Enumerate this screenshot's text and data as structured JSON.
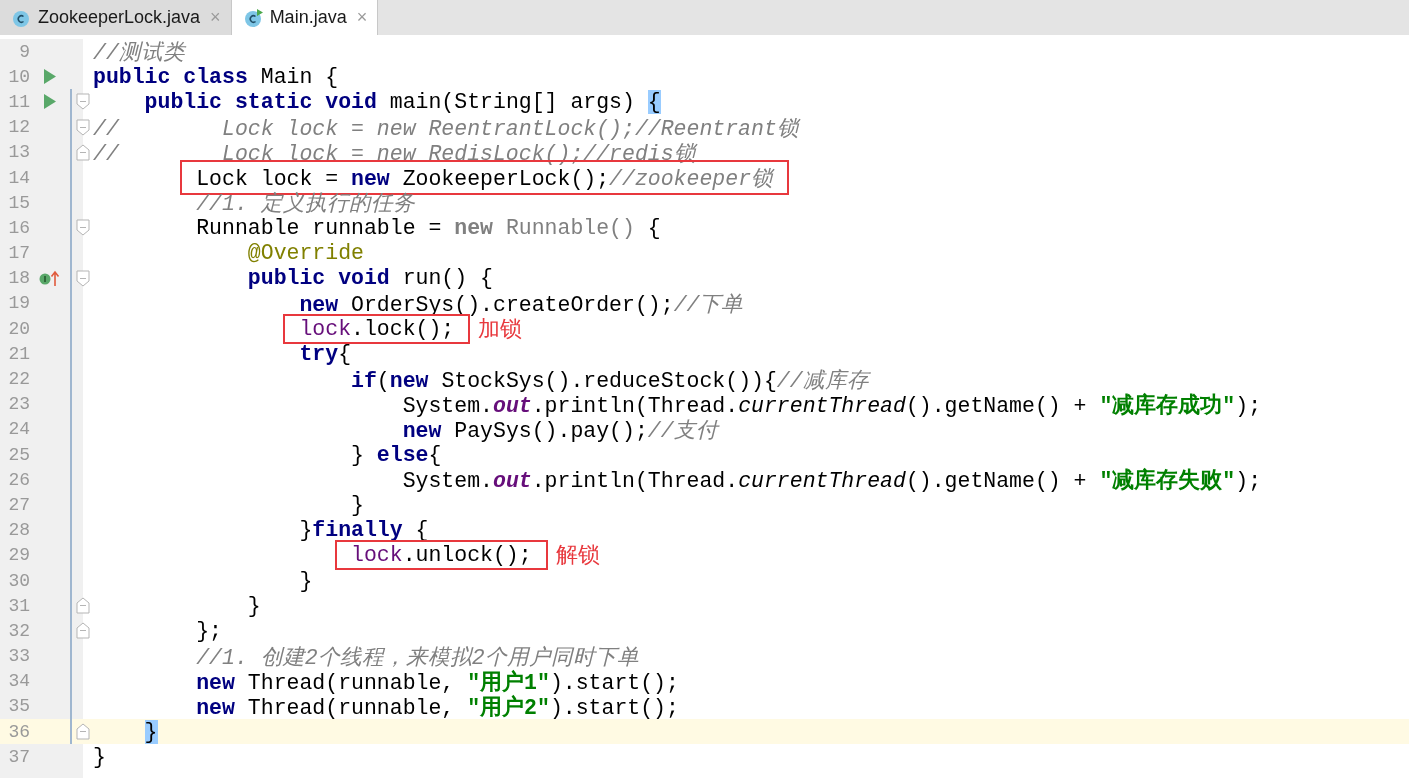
{
  "tabs": [
    {
      "label": "ZookeeperLock.java",
      "selected": false,
      "executable": false,
      "close": "×"
    },
    {
      "label": "Main.java",
      "selected": true,
      "executable": true,
      "close": "×"
    }
  ],
  "lines": [
    {
      "number": "9",
      "current": false,
      "scope": false,
      "tokens": [
        {
          "kind": "comment",
          "text": "//测试类"
        }
      ]
    },
    {
      "number": "10",
      "current": false,
      "scope": false,
      "run_icon": true,
      "tokens": [
        {
          "kind": "keyword",
          "text": "public class"
        },
        {
          "kind": "plain",
          "text": " Main {"
        }
      ]
    },
    {
      "number": "11",
      "current": false,
      "scope": true,
      "run_icon": true,
      "fold_start": true,
      "tokens": [
        {
          "kind": "keyword",
          "text": "    public static void"
        },
        {
          "kind": "plain",
          "text": " main(String[] args) "
        },
        {
          "kind": "brace",
          "text": "{"
        }
      ]
    },
    {
      "number": "12",
      "current": false,
      "scope": true,
      "fold_start": true,
      "tokens": [
        {
          "kind": "comment",
          "text": "//        Lock lock = new ReentrantLock();//Reentrant锁"
        }
      ]
    },
    {
      "number": "13",
      "current": false,
      "scope": true,
      "fold_end": true,
      "tokens": [
        {
          "kind": "comment",
          "text": "//        Lock lock = new RedisLock();//redis锁"
        }
      ]
    },
    {
      "number": "14",
      "current": false,
      "scope": true,
      "tokens": [
        {
          "kind": "box",
          "tokens": [
            {
              "kind": "plain",
              "text": "        Lock lock = "
            },
            {
              "kind": "keyword",
              "text": "new"
            },
            {
              "kind": "plain",
              "text": " ZookeeperLock();"
            },
            {
              "kind": "comment",
              "text": "//zookeeper锁"
            }
          ]
        }
      ]
    },
    {
      "number": "15",
      "current": false,
      "scope": true,
      "tokens": [
        {
          "kind": "comment",
          "text": "        //1. 定义执行的任务"
        }
      ]
    },
    {
      "number": "16",
      "current": false,
      "scope": true,
      "fold_start": true,
      "tokens": [
        {
          "kind": "plain",
          "text": "        Runnable runnable = "
        },
        {
          "kind": "dim_keyword",
          "text": "new"
        },
        {
          "kind": "dim",
          "text": " Runnable()"
        },
        {
          "kind": "plain",
          "text": " {"
        }
      ]
    },
    {
      "number": "17",
      "current": false,
      "scope": true,
      "tokens": [
        {
          "kind": "annotation",
          "text": "            @Override"
        }
      ]
    },
    {
      "number": "18",
      "current": false,
      "scope": true,
      "override_icon": true,
      "fold_start": true,
      "tokens": [
        {
          "kind": "keyword",
          "text": "            public void"
        },
        {
          "kind": "plain",
          "text": " run() {"
        }
      ]
    },
    {
      "number": "19",
      "current": false,
      "scope": true,
      "tokens": [
        {
          "kind": "keyword",
          "text": "                new"
        },
        {
          "kind": "plain",
          "text": " OrderSys().createOrder();"
        },
        {
          "kind": "comment",
          "text": "//下单"
        }
      ]
    },
    {
      "number": "20",
      "current": false,
      "scope": true,
      "tokens": [
        {
          "kind": "box",
          "note": "加锁",
          "tokens": [
            {
              "kind": "local",
              "text": "                lock"
            },
            {
              "kind": "plain",
              "text": ".lock();"
            }
          ]
        }
      ]
    },
    {
      "number": "21",
      "current": false,
      "scope": true,
      "tokens": [
        {
          "kind": "keyword",
          "text": "                try"
        },
        {
          "kind": "plain",
          "text": "{"
        }
      ]
    },
    {
      "number": "22",
      "current": false,
      "scope": true,
      "tokens": [
        {
          "kind": "keyword",
          "text": "                    if"
        },
        {
          "kind": "plain",
          "text": "("
        },
        {
          "kind": "keyword",
          "text": "new"
        },
        {
          "kind": "plain",
          "text": " StockSys().reduceStock()){"
        },
        {
          "kind": "comment",
          "text": "//减库存"
        }
      ]
    },
    {
      "number": "23",
      "current": false,
      "scope": true,
      "tokens": [
        {
          "kind": "plain",
          "text": "                        System."
        },
        {
          "kind": "field",
          "text": "out"
        },
        {
          "kind": "plain",
          "text": ".println(Thread."
        },
        {
          "kind": "static",
          "text": "currentThread"
        },
        {
          "kind": "plain",
          "text": "().getName() + "
        },
        {
          "kind": "string",
          "text": "\"减库存成功\""
        },
        {
          "kind": "plain",
          "text": ");"
        }
      ]
    },
    {
      "number": "24",
      "current": false,
      "scope": true,
      "tokens": [
        {
          "kind": "keyword",
          "text": "                        new"
        },
        {
          "kind": "plain",
          "text": " PaySys().pay();"
        },
        {
          "kind": "comment",
          "text": "//支付"
        }
      ]
    },
    {
      "number": "25",
      "current": false,
      "scope": true,
      "tokens": [
        {
          "kind": "plain",
          "text": "                    } "
        },
        {
          "kind": "keyword",
          "text": "else"
        },
        {
          "kind": "plain",
          "text": "{"
        }
      ]
    },
    {
      "number": "26",
      "current": false,
      "scope": true,
      "tokens": [
        {
          "kind": "plain",
          "text": "                        System."
        },
        {
          "kind": "field",
          "text": "out"
        },
        {
          "kind": "plain",
          "text": ".println(Thread."
        },
        {
          "kind": "static",
          "text": "currentThread"
        },
        {
          "kind": "plain",
          "text": "().getName() + "
        },
        {
          "kind": "string",
          "text": "\"减库存失败\""
        },
        {
          "kind": "plain",
          "text": ");"
        }
      ]
    },
    {
      "number": "27",
      "current": false,
      "scope": true,
      "tokens": [
        {
          "kind": "plain",
          "text": "                    }"
        }
      ]
    },
    {
      "number": "28",
      "current": false,
      "scope": true,
      "tokens": [
        {
          "kind": "plain",
          "text": "                }"
        },
        {
          "kind": "keyword",
          "text": "finally"
        },
        {
          "kind": "plain",
          "text": " {"
        }
      ]
    },
    {
      "number": "29",
      "current": false,
      "scope": true,
      "tokens": [
        {
          "kind": "box",
          "note": "解锁",
          "tokens": [
            {
              "kind": "local",
              "text": "                    lock"
            },
            {
              "kind": "plain",
              "text": ".unlock();"
            }
          ]
        }
      ]
    },
    {
      "number": "30",
      "current": false,
      "scope": true,
      "tokens": [
        {
          "kind": "plain",
          "text": "                }"
        }
      ]
    },
    {
      "number": "31",
      "current": false,
      "scope": true,
      "fold_end": true,
      "tokens": [
        {
          "kind": "plain",
          "text": "            }"
        }
      ]
    },
    {
      "number": "32",
      "current": false,
      "scope": true,
      "fold_end": true,
      "tokens": [
        {
          "kind": "plain",
          "text": "        };"
        }
      ]
    },
    {
      "number": "33",
      "current": false,
      "scope": true,
      "tokens": [
        {
          "kind": "comment",
          "text": "        //1. 创建2个线程，来模拟2个用户同时下单"
        }
      ]
    },
    {
      "number": "34",
      "current": false,
      "scope": true,
      "tokens": [
        {
          "kind": "keyword",
          "text": "        new"
        },
        {
          "kind": "plain",
          "text": " Thread(runnable, "
        },
        {
          "kind": "string",
          "text": "\"用户1\""
        },
        {
          "kind": "plain",
          "text": ").start();"
        }
      ]
    },
    {
      "number": "35",
      "current": false,
      "scope": true,
      "tokens": [
        {
          "kind": "keyword",
          "text": "        new"
        },
        {
          "kind": "plain",
          "text": " Thread(runnable, "
        },
        {
          "kind": "string",
          "text": "\"用户2\""
        },
        {
          "kind": "plain",
          "text": ").start();"
        }
      ]
    },
    {
      "number": "36",
      "current": true,
      "scope": true,
      "fold_end": true,
      "tokens": [
        {
          "kind": "brace",
          "text": "    }"
        }
      ]
    },
    {
      "number": "37",
      "current": false,
      "scope": false,
      "tokens": [
        {
          "kind": "plain",
          "text": "}"
        }
      ]
    }
  ]
}
